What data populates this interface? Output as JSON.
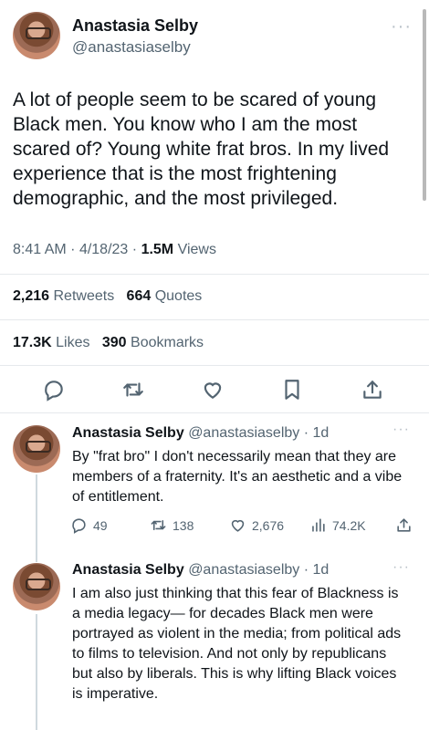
{
  "main_tweet": {
    "author_name": "Anastasia Selby",
    "handle": "@anastasiaselby",
    "text": "A lot of people seem to be scared of young Black men. You know who I am the most scared of? Young white frat bros. In my lived experience that is the most frightening demographic, and the most privileged.",
    "time": "8:41 AM",
    "date": "4/18/23",
    "separator": "·",
    "views_count": "1.5M",
    "views_label": "Views",
    "retweets_count": "2,216",
    "retweets_label": "Retweets",
    "quotes_count": "664",
    "quotes_label": "Quotes",
    "likes_count": "17.3K",
    "likes_label": "Likes",
    "bookmarks_count": "390",
    "bookmarks_label": "Bookmarks"
  },
  "replies": [
    {
      "author_name": "Anastasia Selby",
      "handle_time": "@anastasiaselby · 1d",
      "text": "By \"frat bro\" I don't necessarily mean that they are members of a fraternity. It's an aesthetic and a vibe of entitlement.",
      "replies_count": "49",
      "retweets_count": "138",
      "likes_count": "2,676",
      "views_count": "74.2K"
    },
    {
      "author_name": "Anastasia Selby",
      "handle_time": "@anastasiaselby · 1d",
      "text": "I am also just thinking that this fear of Blackness is a media legacy— for decades Black men were portrayed as violent in the media; from political ads to films to television. And not only by republicans but also by liberals. This is why lifting Black voices is imperative."
    }
  ],
  "icons": {
    "more": "more-dots-icon",
    "reply": "speech-bubble-icon",
    "retweet": "retweet-arrows-icon",
    "like": "heart-icon",
    "bookmark": "bookmark-icon",
    "share": "share-upload-icon",
    "views": "bar-chart-icon"
  },
  "colors": {
    "text": "#0f1419",
    "secondary": "#536471",
    "divider": "#e6e9ec",
    "thread_line": "#cfd9de"
  }
}
